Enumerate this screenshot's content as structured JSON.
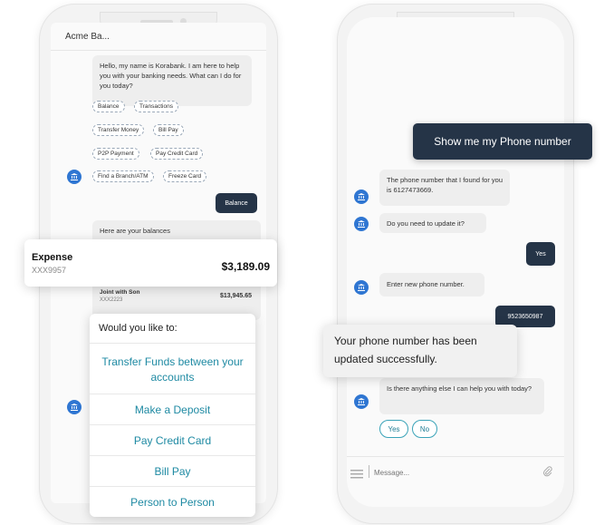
{
  "left": {
    "app_title": "Acme Ba...",
    "greeting": "Hello, my name is Korabank. I am here to help you with your banking needs. What can I do for you today?",
    "quick_replies": [
      "Balance",
      "Transactions",
      "Transfer Money",
      "Bill Pay",
      "P2P Payment",
      "Pay Credit Card",
      "Find a Branch/ATM",
      "Freeze Card"
    ],
    "user_message": "Balance",
    "balances_intro": "Here are your balances",
    "expense_card": {
      "label": "Expense",
      "account": "XXX9957",
      "amount": "$3,189.09"
    },
    "joint_account": {
      "label": "Joint with Son",
      "account": "XXX2223",
      "amount": "$13,945.65"
    },
    "menu": {
      "title": "Would you like to:",
      "options": [
        "Transfer Funds between your accounts",
        "Make a Deposit",
        "Pay Credit Card",
        "Bill Pay",
        "Person to Person"
      ]
    }
  },
  "right": {
    "callout_top": "Show me my Phone number",
    "bot_msg_1": "The phone number that I found for you is 6127473669.",
    "bot_msg_2": "Do you need to update it?",
    "user_yes": "Yes",
    "bot_msg_3": "Enter new phone number.",
    "user_phone": "9523650987",
    "callout_bottom": "Your phone number has been updated successfully.",
    "bot_msg_4": "Is there anything else I can help you with today?",
    "btn_yes": "Yes",
    "btn_no": "No",
    "input_placeholder": "Message..."
  },
  "colors": {
    "bot_icon": "#2f76d2",
    "user_bubble": "#253447",
    "accent_link": "#1f8aa3"
  }
}
